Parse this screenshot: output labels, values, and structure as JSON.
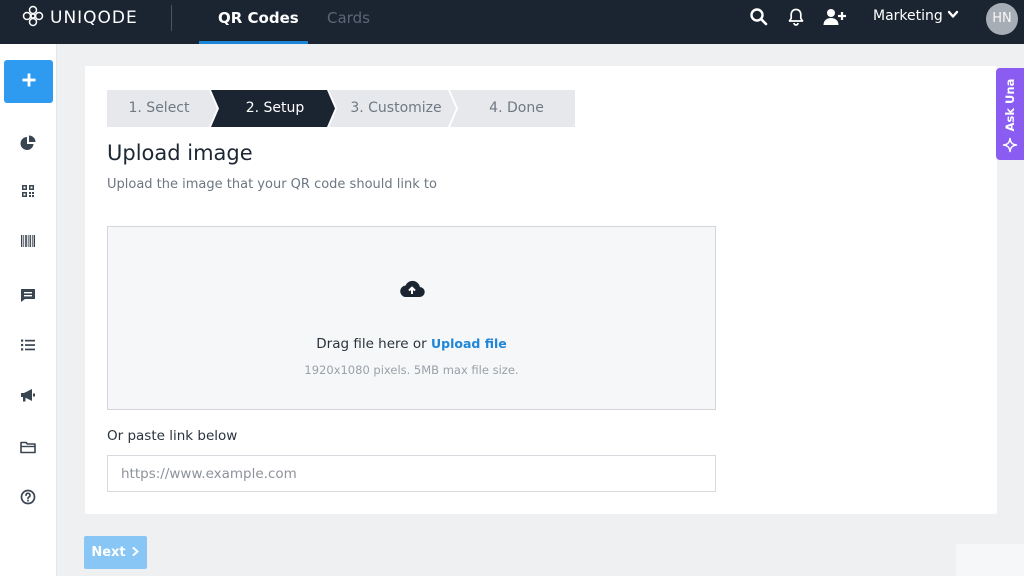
{
  "header": {
    "logo_text": "UNIQODE",
    "tabs": [
      {
        "label": "QR Codes",
        "active": true
      },
      {
        "label": "Cards",
        "active": false
      }
    ],
    "workspace": "Marketing",
    "avatar_initials": "HN",
    "icons": [
      "search-icon",
      "bell-icon",
      "add-user-icon",
      "chevron-down-icon"
    ]
  },
  "sidebar": {
    "create_icon": "plus-icon",
    "items": [
      {
        "icon": "analytics-pie-icon"
      },
      {
        "icon": "qr-code-icon"
      },
      {
        "icon": "barcode-icon"
      },
      {
        "icon": "message-icon"
      },
      {
        "icon": "list-icon"
      },
      {
        "icon": "megaphone-icon"
      },
      {
        "icon": "folder-icon"
      },
      {
        "icon": "help-icon"
      }
    ]
  },
  "stepper": {
    "steps": [
      {
        "label": "1. Select",
        "state": "done"
      },
      {
        "label": "2. Setup",
        "state": "active"
      },
      {
        "label": "3. Customize",
        "state": "pending"
      },
      {
        "label": "4. Done",
        "state": "pending"
      }
    ]
  },
  "main": {
    "title": "Upload image",
    "subtitle": "Upload the image that your QR code should link to",
    "dropzone": {
      "icon": "cloud-upload-icon",
      "drag_text": "Drag file here or ",
      "upload_link": "Upload file",
      "hint": "1920x1080 pixels. 5MB max file size."
    },
    "paste_label": "Or paste link below",
    "url_placeholder": "https://www.example.com",
    "url_value": ""
  },
  "ask_una": {
    "label": "Ask Una",
    "icon": "sparkle-icon"
  },
  "footer": {
    "next_label": "Next",
    "next_icon": "chevron-right-icon"
  },
  "colors": {
    "header_bg": "#1b2532",
    "accent": "#2f9bf0",
    "active_step": "#1b2532",
    "inactive_step": "#e6e8eb",
    "ask_una": "#8a5cf2",
    "next_disabled": "#88c6f6"
  }
}
